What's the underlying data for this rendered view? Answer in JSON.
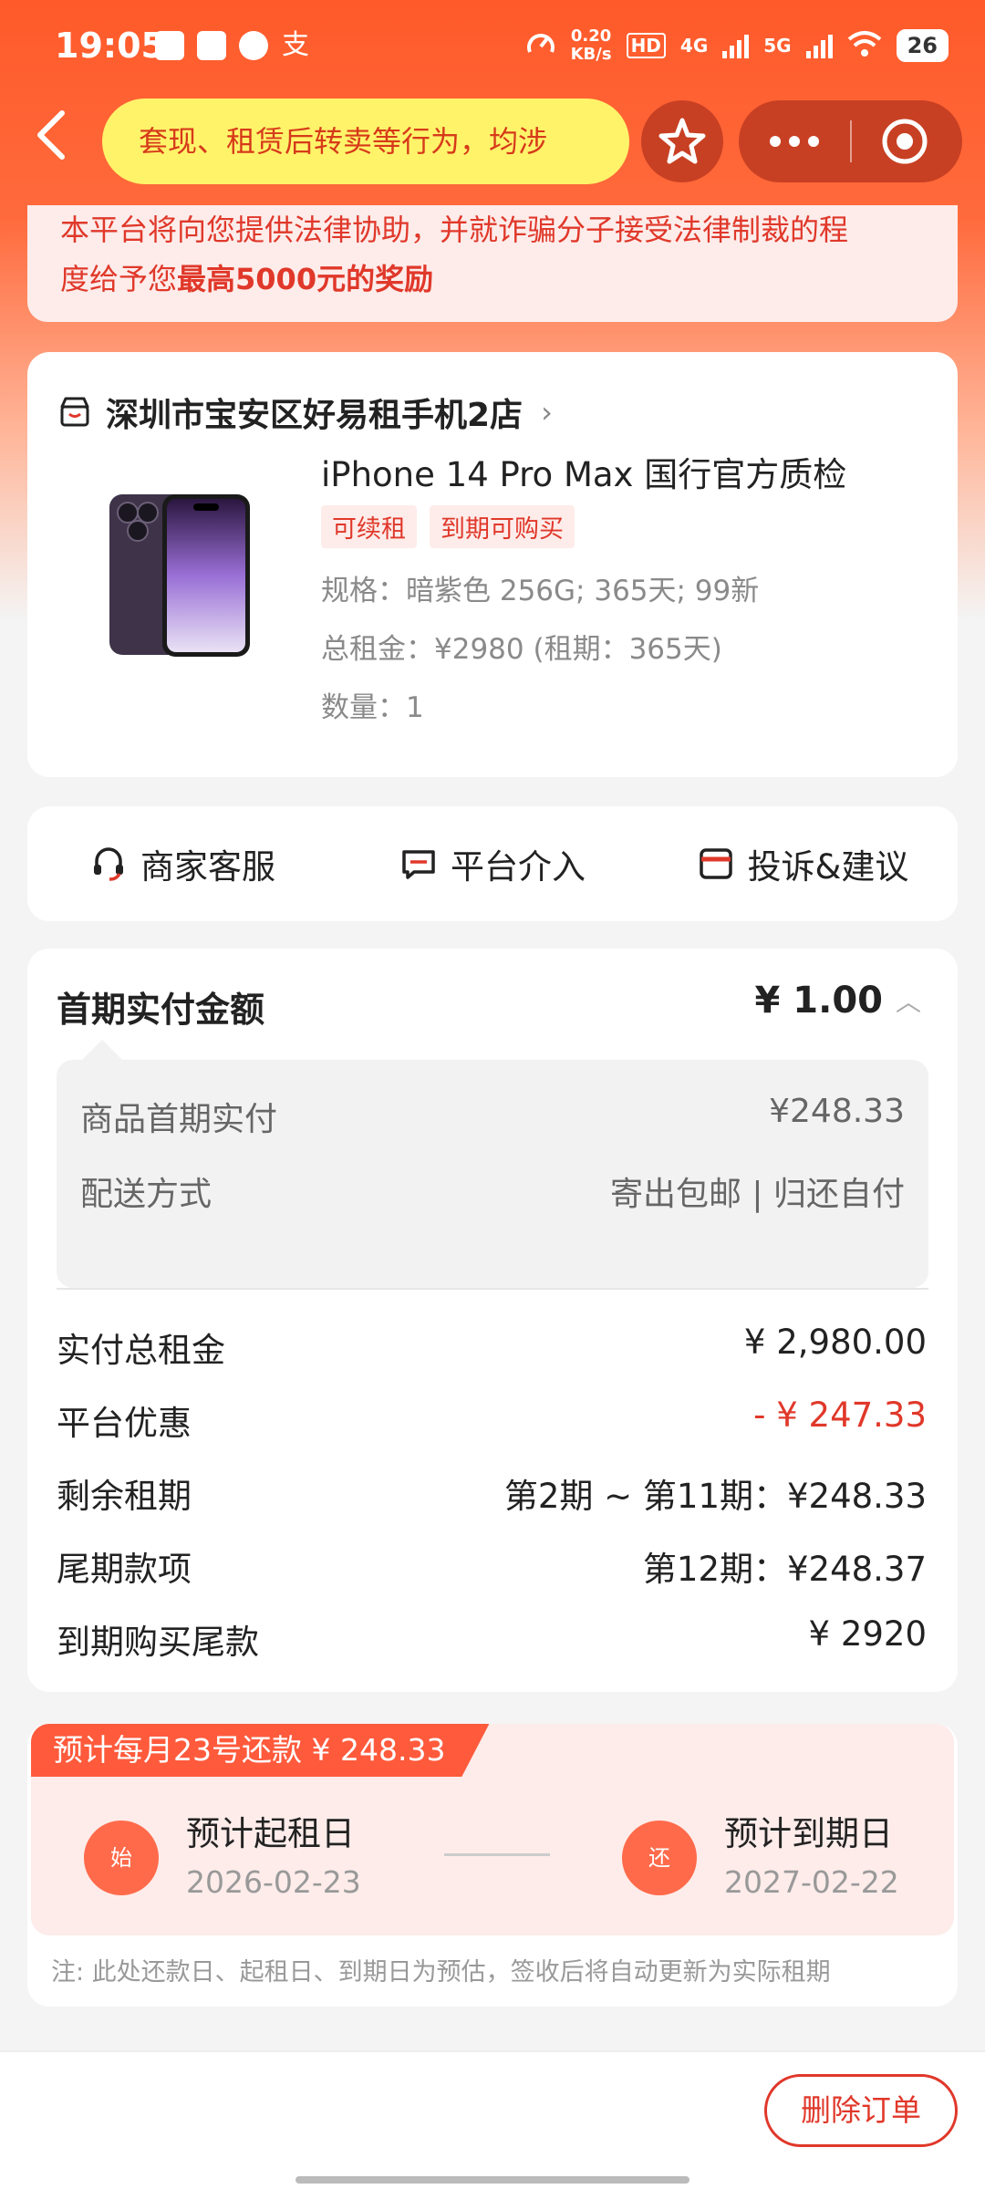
{
  "status_bar": {
    "time": "19:05",
    "net_speed_value": "0.20",
    "net_speed_unit": "KB/s",
    "hd_label": "HD",
    "lte_label": "4G",
    "fiveg_label": "5G",
    "battery": "26",
    "pay_icon_glyph": "支"
  },
  "nav": {
    "notice_text": "套现、租赁后转卖等行为，均涉",
    "back_icon": "chevron-left-icon",
    "favorite_icon": "star-icon",
    "more_icon": "more-icon",
    "close_icon": "target-icon"
  },
  "warning": {
    "line1": "本平台将向您提供法律协助，并就诈骗分子接受法律制裁的程",
    "line2_prefix": "度给予您",
    "line2_bold": "最高5000元的奖励"
  },
  "product": {
    "store_name": "深圳市宝安区好易租手机2店",
    "title": "iPhone 14 Pro Max 国行官方质检",
    "tags": [
      "可续租",
      "到期可购买"
    ],
    "spec": "规格：暗紫色 256G; 365天; 99新",
    "total_rent": "总租金：¥2980 (租期：365天)",
    "quantity": "数量：1"
  },
  "actions": {
    "service": "商家客服",
    "platform": "平台介入",
    "complaint": "投诉&建议"
  },
  "payment": {
    "title": "首期实付金额",
    "amount": "¥ 1.00",
    "detail": {
      "first_pay_label": "商品首期实付",
      "first_pay_value": "¥248.33",
      "delivery_label": "配送方式",
      "delivery_value": "寄出包邮 | 归还自付"
    },
    "rows": {
      "total_label": "实付总租金",
      "total_value": "¥ 2,980.00",
      "discount_label": "平台优惠",
      "discount_value": "- ¥ 247.33",
      "remaining_label": "剩余租期",
      "remaining_value": "第2期 ~ 第11期：¥248.33",
      "last_label": "尾期款项",
      "last_value": "第12期：¥248.37",
      "buyout_label": "到期购买尾款",
      "buyout_value": "¥ 2920"
    }
  },
  "schedule": {
    "flag": "预计每月23号还款 ¥ 248.33",
    "start_icon": "始",
    "start_label": "预计起租日",
    "start_date": "2026-02-23",
    "end_icon": "还",
    "end_label": "预计到期日",
    "end_date": "2027-02-22",
    "note": "注: 此处还款日、起租日、到期日为预估，签收后将自动更新为实际租期"
  },
  "bottom": {
    "delete_label": "删除订单"
  },
  "colors": {
    "brand_orange": "#ff5a2a",
    "accent_red": "#e0382a",
    "notice_yellow": "#fff36a"
  }
}
